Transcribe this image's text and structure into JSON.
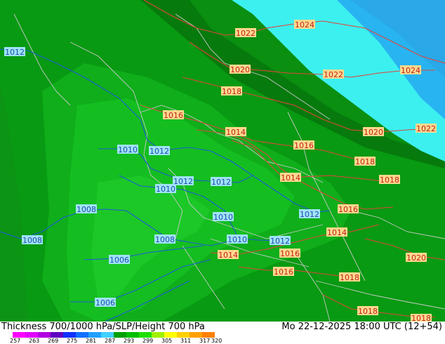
{
  "footer": {
    "title": "Thickness 700/1000 hPa/SLP/Height 700 hPa",
    "datetime": "Mo 22-12-2025 18:00 UTC (12+54)"
  },
  "colorscale": {
    "colors": [
      "#ff00ff",
      "#e000ff",
      "#b000e0",
      "#6000c0",
      "#1030ff",
      "#1070ff",
      "#20a0ff",
      "#40d0ff",
      "#00a000",
      "#00c000",
      "#20e000",
      "#a0f000",
      "#ffff00",
      "#ffd000",
      "#ffa000",
      "#ff8000"
    ],
    "tick_labels": [
      "257",
      "263",
      "269",
      "275",
      "281",
      "287",
      "293",
      "299",
      "305",
      "311",
      "317",
      "320"
    ]
  },
  "slp_labels": {
    "blue": [
      "1012",
      "1010",
      "1012",
      "1010",
      "1012",
      "1012",
      "1008",
      "1008",
      "1010",
      "1012",
      "1006",
      "1008",
      "1010",
      "1012",
      "1006"
    ],
    "red": [
      "1022",
      "1024",
      "1020",
      "1022",
      "1024",
      "1018",
      "1016",
      "1014",
      "1020",
      "1022",
      "1016",
      "1014",
      "1018",
      "1018",
      "1014",
      "1016",
      "1014",
      "1016",
      "1016",
      "1018",
      "1020",
      "1018",
      "1018"
    ]
  },
  "colors": {
    "isobar_blue": "#1e5bd6",
    "isobar_red": "#e0463c",
    "border": "#c8c8c8",
    "cyan_region": "#3cf0f0",
    "blue_region": "#28b4f0"
  }
}
